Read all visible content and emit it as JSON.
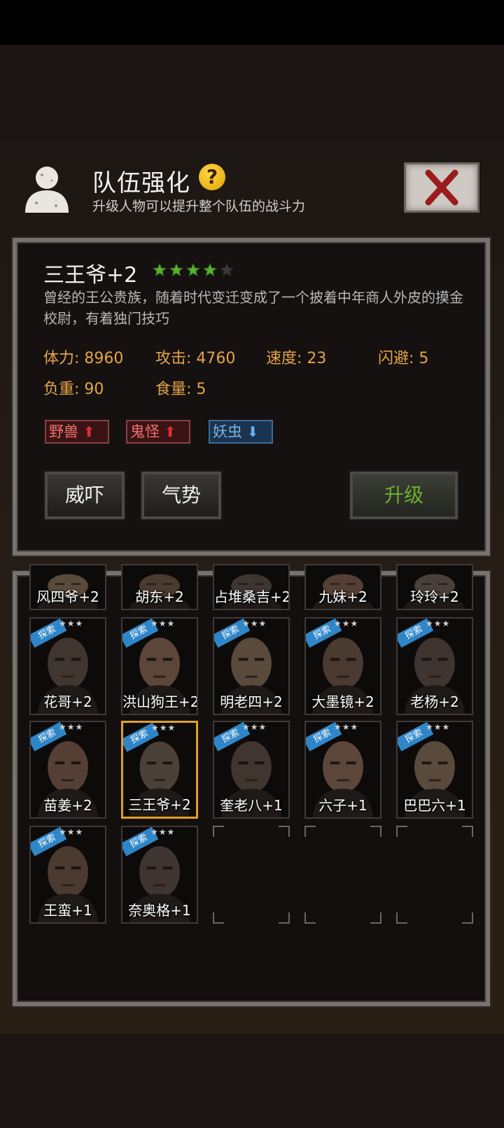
{
  "header": {
    "title": "队伍强化",
    "help": "?",
    "subtitle": "升级人物可以提升整个队伍的战斗力"
  },
  "character": {
    "name": "三王爷+2",
    "rating": 4,
    "max_rating": 5,
    "description": "曾经的王公贵族，随着时代变迁变成了一个披着中年商人外皮的摸金校尉，有着独门技巧",
    "stats": [
      {
        "label": "体力: 8960"
      },
      {
        "label": "攻击: 4760"
      },
      {
        "label": "速度: 23"
      },
      {
        "label": "闪避: 5"
      },
      {
        "label": "负重: 90"
      },
      {
        "label": "食量: 5"
      }
    ],
    "tags": [
      {
        "label": "野兽",
        "direction": "up"
      },
      {
        "label": "鬼怪",
        "direction": "up"
      },
      {
        "label": "妖虫",
        "direction": "down"
      }
    ]
  },
  "actions": {
    "skill1": "威吓",
    "skill2": "气势",
    "upgrade": "升级"
  },
  "roster": {
    "badge": "探索",
    "stars_glyph": "★★★",
    "top_row": [
      "风四爷+2",
      "胡东+2",
      "占堆桑吉+2",
      "九妹+2",
      "玲玲+2"
    ],
    "rows": [
      [
        "花哥+2",
        "洪山狗王+2",
        "明老四+2",
        "大墨镜+2",
        "老杨+2"
      ],
      [
        "苗姜+2",
        "三王爷+2",
        "奎老八+1",
        "六子+1",
        "巴巴六+1"
      ],
      [
        "王蛮+1",
        "奈奥格+1"
      ]
    ],
    "selected": "三王爷+2"
  },
  "colors": {
    "stat": "#e5a348",
    "upgrade_text": "#6fae2c",
    "selected_border": "#e0a020",
    "badge": "#2e86c8"
  }
}
